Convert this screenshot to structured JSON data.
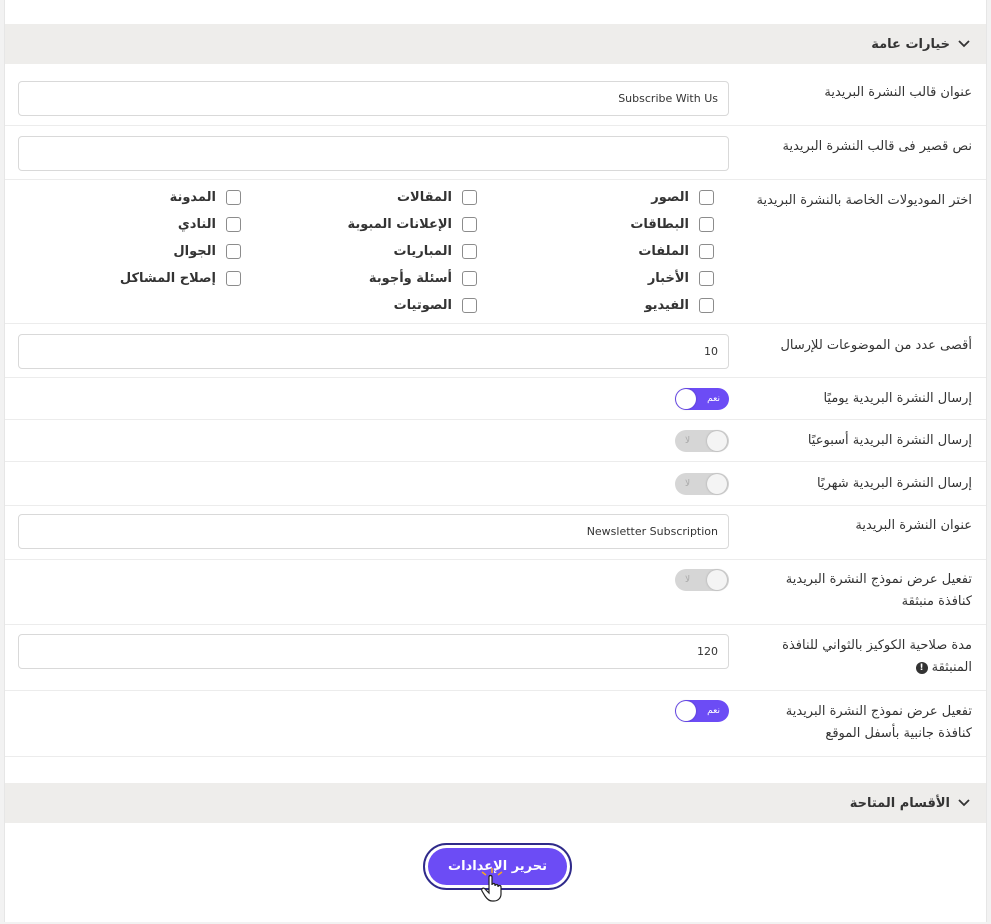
{
  "general_section": {
    "title": "خيارات عامة"
  },
  "fields": {
    "template_title": {
      "label": "عنوان قالب النشرة البريدية",
      "value": "Subscribe With Us"
    },
    "short_text": {
      "label": "نص قصير فى قالب النشرة البريدية",
      "value": ""
    },
    "modules": {
      "label": "اختر الموديولات الخاصة بالنشرة البريدية",
      "col1": [
        "الصور",
        "البطاقات",
        "الملفات",
        "الأخبار",
        "الفيديو"
      ],
      "col2": [
        "المقالات",
        "الإعلانات المبوبة",
        "المباريات",
        "أسئلة وأجوبة",
        "الصوتيات"
      ],
      "col3": [
        "المدونة",
        "النادي",
        "الجوال",
        "إصلاح المشاكل"
      ]
    },
    "max_topics": {
      "label": "أقصى عدد من الموضوعات للإرسال",
      "value": "10"
    },
    "daily": {
      "label": "إرسال النشرة البريدية يوميًا",
      "state": "نعم"
    },
    "weekly": {
      "label": "إرسال النشرة البريدية أسبوعيًا",
      "state": "لا"
    },
    "monthly": {
      "label": "إرسال النشرة البريدية شهريًا",
      "state": "لا"
    },
    "newsletter_title": {
      "label": "عنوان النشرة البريدية",
      "value": "Newsletter Subscription"
    },
    "popup": {
      "label": "تفعيل عرض نموذج النشرة البريدية كنافذة منبثقة",
      "state": "لا"
    },
    "cookie_duration": {
      "label": "مدة صلاحية الكوكيز بالثواني للنافذة المنبثقة",
      "value": "120"
    },
    "sidebar_form": {
      "label": "تفعيل عرض نموذج النشرة البريدية كنافذة جانبية بأسفل الموقع",
      "state": "نعم"
    }
  },
  "sections_section": {
    "title": "الأقسام المتاحة"
  },
  "submit": {
    "label": "تحرير الإعدادات"
  },
  "colors": {
    "accent": "#6c4cf5",
    "header_bg": "#eeedeb",
    "toggle_off": "#d6d6d6"
  },
  "icons": {
    "chevron": "chevron-down-icon",
    "info": "info-icon",
    "cursor": "hand-pointer-icon"
  }
}
